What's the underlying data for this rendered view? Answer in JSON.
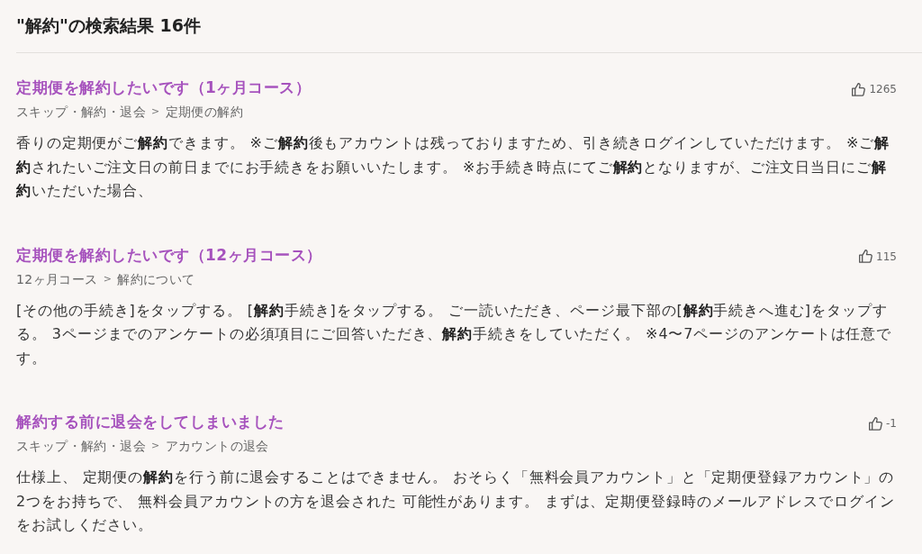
{
  "heading": "\"解約\"の検索結果 16件",
  "results": [
    {
      "title": "定期便を解約したいです（1ヶ月コース）",
      "likes": "1265",
      "breadcrumb": {
        "items": [
          "スキップ・解約・退会",
          "定期便の解約"
        ],
        "separator": ">"
      },
      "snippet": "香りの定期便がご**解約**できます。 ※ご**解約**後もアカウントは残っておりますため、引き続きログインしていただけます。 ※ご**解約**されたいご注文日の前日までにお手続きをお願いいたします。 ※お手続き時点にてご**解約**となりますが、ご注文日当日にご**解約**いただいた場合、"
    },
    {
      "title": "定期便を解約したいです（12ヶ月コース）",
      "likes": "115",
      "breadcrumb": {
        "items": [
          "12ヶ月コース",
          "解約について"
        ],
        "separator": ">"
      },
      "snippet": "[その他の手続き]をタップする。 [**解約**手続き]をタップする。 ご一読いただき、ページ最下部の[**解約**手続きへ進む]をタップする。 3ページまでのアンケートの必須項目にご回答いただき、**解約**手続きをしていただく。 ※4〜7ページのアンケートは任意です。"
    },
    {
      "title": "解約する前に退会をしてしまいました",
      "likes": "-1",
      "breadcrumb": {
        "items": [
          "スキップ・解約・退会",
          "アカウントの退会"
        ],
        "separator": ">"
      },
      "snippet": "仕様上、 定期便の**解約**を行う前に退会することはできません。 おそらく「無料会員アカウント」と「定期便登録アカウント」の2つをお持ちで、 無料会員アカウントの方を退会された 可能性があります。 まずは、定期便登録時のメールアドレスでログインをお試しください。"
    }
  ]
}
